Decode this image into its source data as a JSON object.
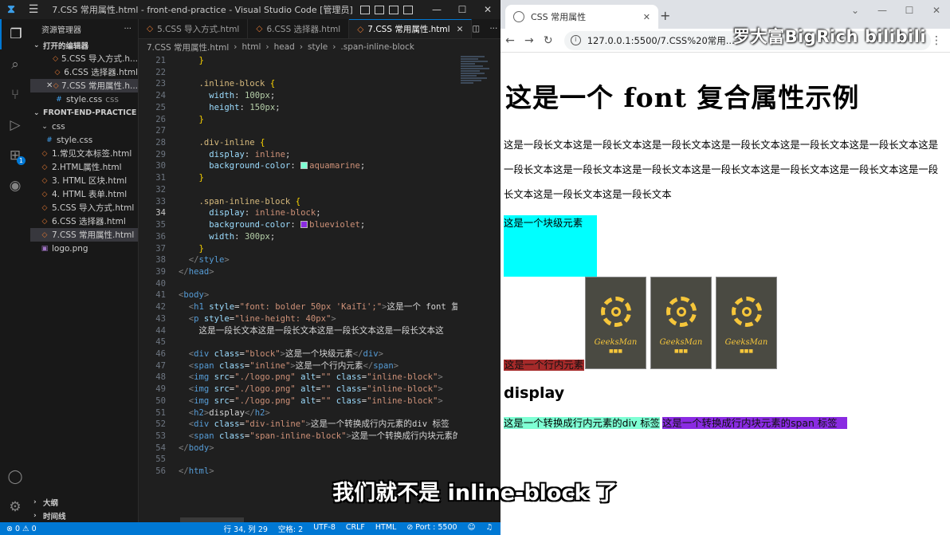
{
  "vscode": {
    "window_title": "7.CSS 常用属性.html - front-end-practice - Visual Studio Code [管理员]",
    "explorer": {
      "header": "资源管理器",
      "open_editors_title": "打开的编辑器",
      "open_editors": [
        {
          "name": "5.CSS 导入方式.h...",
          "type": "html"
        },
        {
          "name": "6.CSS 选择器.html",
          "type": "html"
        },
        {
          "name": "7.CSS 常用属性.h...",
          "type": "html",
          "selected": true
        },
        {
          "name": "style.css",
          "suffix": "css",
          "type": "css"
        }
      ],
      "project_title": "FRONT-END-PRACTICE",
      "files": [
        {
          "name": "css",
          "type": "folder"
        },
        {
          "name": "style.css",
          "type": "css"
        },
        {
          "name": "1.常见文本标签.html",
          "type": "html"
        },
        {
          "name": "2.HTML属性.html",
          "type": "html"
        },
        {
          "name": "3. HTML 区块.html",
          "type": "html"
        },
        {
          "name": "4. HTML 表单.html",
          "type": "html"
        },
        {
          "name": "5.CSS 导入方式.html",
          "type": "html"
        },
        {
          "name": "6.CSS 选择器.html",
          "type": "html"
        },
        {
          "name": "7.CSS 常用属性.html",
          "type": "html",
          "selected": true
        },
        {
          "name": "logo.png",
          "type": "img"
        }
      ],
      "outline_label": "大纲",
      "timeline_label": "时间线"
    },
    "tabs": [
      {
        "label": "5.CSS 导入方式.html",
        "active": false
      },
      {
        "label": "6.CSS 选择器.html",
        "active": false
      },
      {
        "label": "7.CSS 常用属性.html",
        "active": true
      }
    ],
    "breadcrumbs": [
      "7.CSS 常用属性.html",
      "html",
      "head",
      "style",
      ".span-inline-block"
    ],
    "current_line": 34,
    "statusbar": {
      "problems": "⊗ 0 ⚠ 0",
      "position": "行 34, 列 29",
      "spaces": "空格: 2",
      "encoding": "UTF-8",
      "eol": "CRLF",
      "language": "HTML",
      "port": "⊘ Port : 5500"
    }
  },
  "browser": {
    "tab_title": "CSS 常用属性",
    "url": "127.0.0.1:5500/7.CSS%20常用...",
    "page": {
      "h1": "这是一个 font 复合属性示例",
      "paragraph": "这是一段长文本这是一段长文本这是一段长文本这是一段长文本这是一段长文本这是一段长文本这是一段长文本这是一段长文本这是一段长文本这是一段长文本这是一段长文本这是一段长文本这是一段长文本这是一段长文本这是一段长文本",
      "block_text": "这是一个块级元素",
      "inline_text": "这是一个行内元素",
      "logo_brand": "GeeksMan",
      "logo_dots": "■■■",
      "h2": "display",
      "div_inline_text": "这是一个转换成行内元素的div 标签",
      "span_ib_text": "这是一个转换成行内块元素的span 标签"
    }
  },
  "watermark": "罗大富BigRich bilibili",
  "subtitle": "我们就不是 inline-block 了",
  "colors": {
    "block": "#00ffff",
    "inline": "#a52a2a",
    "div_inline": "#7fffd4",
    "span_inline_block": "#8a2be2",
    "accent": "#0078d4"
  },
  "code_lines": [
    {
      "n": 21,
      "segs": [
        [
          "t-brk",
          "    }"
        ]
      ]
    },
    {
      "n": 22,
      "segs": [
        [
          "t-txt",
          ""
        ]
      ]
    },
    {
      "n": 23,
      "segs": [
        [
          "t-sel",
          "    .inline-block "
        ],
        [
          "t-brk",
          "{"
        ]
      ]
    },
    {
      "n": 24,
      "segs": [
        [
          "t-prop",
          "      width"
        ],
        [
          "t-txt",
          ": "
        ],
        [
          "t-num",
          "100px"
        ],
        [
          "t-txt",
          ";"
        ]
      ]
    },
    {
      "n": 25,
      "segs": [
        [
          "t-prop",
          "      height"
        ],
        [
          "t-txt",
          ": "
        ],
        [
          "t-num",
          "150px"
        ],
        [
          "t-txt",
          ";"
        ]
      ]
    },
    {
      "n": 26,
      "segs": [
        [
          "t-brk",
          "    }"
        ]
      ]
    },
    {
      "n": 27,
      "segs": [
        [
          "t-txt",
          ""
        ]
      ]
    },
    {
      "n": 28,
      "segs": [
        [
          "t-sel",
          "    .div-inline "
        ],
        [
          "t-brk",
          "{"
        ]
      ]
    },
    {
      "n": 29,
      "segs": [
        [
          "t-prop",
          "      display"
        ],
        [
          "t-txt",
          ": "
        ],
        [
          "t-val",
          "inline"
        ],
        [
          "t-txt",
          ";"
        ]
      ]
    },
    {
      "n": 30,
      "segs": [
        [
          "t-prop",
          "      background-color"
        ],
        [
          "t-txt",
          ": "
        ],
        [
          "swatch",
          "#7fffd4"
        ],
        [
          "t-val",
          "aquamarine"
        ],
        [
          "t-txt",
          ";"
        ]
      ]
    },
    {
      "n": 31,
      "segs": [
        [
          "t-brk",
          "    }"
        ]
      ]
    },
    {
      "n": 32,
      "segs": [
        [
          "t-txt",
          ""
        ]
      ]
    },
    {
      "n": 33,
      "segs": [
        [
          "t-sel",
          "    .span-inline-block "
        ],
        [
          "t-brk",
          "{"
        ]
      ]
    },
    {
      "n": 34,
      "segs": [
        [
          "t-prop",
          "      display"
        ],
        [
          "t-txt",
          ": "
        ],
        [
          "t-val",
          "inline-block"
        ],
        [
          "t-txt",
          ";"
        ]
      ]
    },
    {
      "n": 35,
      "segs": [
        [
          "t-prop",
          "      background-color"
        ],
        [
          "t-txt",
          ": "
        ],
        [
          "swatch",
          "#8a2be2"
        ],
        [
          "t-val",
          "blueviolet"
        ],
        [
          "t-txt",
          ";"
        ]
      ]
    },
    {
      "n": 36,
      "segs": [
        [
          "t-prop",
          "      width"
        ],
        [
          "t-txt",
          ": "
        ],
        [
          "t-num",
          "300px"
        ],
        [
          "t-txt",
          ";"
        ]
      ]
    },
    {
      "n": 37,
      "segs": [
        [
          "t-brk",
          "    }"
        ]
      ]
    },
    {
      "n": 38,
      "segs": [
        [
          "t-punct",
          "  </"
        ],
        [
          "t-tag",
          "style"
        ],
        [
          "t-punct",
          ">"
        ]
      ]
    },
    {
      "n": 39,
      "segs": [
        [
          "t-punct",
          "</"
        ],
        [
          "t-tag",
          "head"
        ],
        [
          "t-punct",
          ">"
        ]
      ]
    },
    {
      "n": 40,
      "segs": [
        [
          "t-txt",
          ""
        ]
      ]
    },
    {
      "n": 41,
      "segs": [
        [
          "t-punct",
          "<"
        ],
        [
          "t-tag",
          "body"
        ],
        [
          "t-punct",
          ">"
        ]
      ]
    },
    {
      "n": 42,
      "segs": [
        [
          "t-punct",
          "  <"
        ],
        [
          "t-tag",
          "h1 "
        ],
        [
          "t-attr",
          "style"
        ],
        [
          "t-txt",
          "="
        ],
        [
          "t-str",
          "\"font: bolder 50px 'KaiTi';\""
        ],
        [
          "t-punct",
          ">"
        ],
        [
          "t-txt",
          "这是一个 font 复合"
        ]
      ]
    },
    {
      "n": 43,
      "segs": [
        [
          "t-punct",
          "  <"
        ],
        [
          "t-tag",
          "p "
        ],
        [
          "t-attr",
          "style"
        ],
        [
          "t-txt",
          "="
        ],
        [
          "t-str",
          "\"line-height: 40px\""
        ],
        [
          "t-punct",
          ">"
        ]
      ]
    },
    {
      "n": 44,
      "segs": [
        [
          "t-txt",
          "    这是一段长文本这是一段长文本这是一段长文本这是一段长文本这"
        ]
      ]
    },
    {
      "n": 45,
      "segs": [
        [
          "t-txt",
          ""
        ]
      ]
    },
    {
      "n": 46,
      "segs": [
        [
          "t-punct",
          "  <"
        ],
        [
          "t-tag",
          "div "
        ],
        [
          "t-attr",
          "class"
        ],
        [
          "t-txt",
          "="
        ],
        [
          "t-str",
          "\"block\""
        ],
        [
          "t-punct",
          ">"
        ],
        [
          "t-txt",
          "这是一个块级元素"
        ],
        [
          "t-punct",
          "</"
        ],
        [
          "t-tag",
          "div"
        ],
        [
          "t-punct",
          ">"
        ]
      ]
    },
    {
      "n": 47,
      "segs": [
        [
          "t-punct",
          "  <"
        ],
        [
          "t-tag",
          "span "
        ],
        [
          "t-attr",
          "class"
        ],
        [
          "t-txt",
          "="
        ],
        [
          "t-str",
          "\"inline\""
        ],
        [
          "t-punct",
          ">"
        ],
        [
          "t-txt",
          "这是一个行内元素"
        ],
        [
          "t-punct",
          "</"
        ],
        [
          "t-tag",
          "span"
        ],
        [
          "t-punct",
          ">"
        ]
      ]
    },
    {
      "n": 48,
      "segs": [
        [
          "t-punct",
          "  <"
        ],
        [
          "t-tag",
          "img "
        ],
        [
          "t-attr",
          "src"
        ],
        [
          "t-txt",
          "="
        ],
        [
          "t-str",
          "\"./logo.png\""
        ],
        [
          "t-attr",
          " alt"
        ],
        [
          "t-txt",
          "="
        ],
        [
          "t-str",
          "\"\""
        ],
        [
          "t-attr",
          " class"
        ],
        [
          "t-txt",
          "="
        ],
        [
          "t-str",
          "\"inline-block\""
        ],
        [
          "t-punct",
          ">"
        ]
      ]
    },
    {
      "n": 49,
      "segs": [
        [
          "t-punct",
          "  <"
        ],
        [
          "t-tag",
          "img "
        ],
        [
          "t-attr",
          "src"
        ],
        [
          "t-txt",
          "="
        ],
        [
          "t-str",
          "\"./logo.png\""
        ],
        [
          "t-attr",
          " alt"
        ],
        [
          "t-txt",
          "="
        ],
        [
          "t-str",
          "\"\""
        ],
        [
          "t-attr",
          " class"
        ],
        [
          "t-txt",
          "="
        ],
        [
          "t-str",
          "\"inline-block\""
        ],
        [
          "t-punct",
          ">"
        ]
      ]
    },
    {
      "n": 50,
      "segs": [
        [
          "t-punct",
          "  <"
        ],
        [
          "t-tag",
          "img "
        ],
        [
          "t-attr",
          "src"
        ],
        [
          "t-txt",
          "="
        ],
        [
          "t-str",
          "\"./logo.png\""
        ],
        [
          "t-attr",
          " alt"
        ],
        [
          "t-txt",
          "="
        ],
        [
          "t-str",
          "\"\""
        ],
        [
          "t-attr",
          " class"
        ],
        [
          "t-txt",
          "="
        ],
        [
          "t-str",
          "\"inline-block\""
        ],
        [
          "t-punct",
          ">"
        ]
      ]
    },
    {
      "n": 51,
      "segs": [
        [
          "t-punct",
          "  <"
        ],
        [
          "t-tag",
          "h2"
        ],
        [
          "t-punct",
          ">"
        ],
        [
          "t-txt",
          "display"
        ],
        [
          "t-punct",
          "</"
        ],
        [
          "t-tag",
          "h2"
        ],
        [
          "t-punct",
          ">"
        ]
      ]
    },
    {
      "n": 52,
      "segs": [
        [
          "t-punct",
          "  <"
        ],
        [
          "t-tag",
          "div "
        ],
        [
          "t-attr",
          "class"
        ],
        [
          "t-txt",
          "="
        ],
        [
          "t-str",
          "\"div-inline\""
        ],
        [
          "t-punct",
          ">"
        ],
        [
          "t-txt",
          "这是一个转换成行内元素的div 标签"
        ]
      ]
    },
    {
      "n": 53,
      "segs": [
        [
          "t-punct",
          "  <"
        ],
        [
          "t-tag",
          "span "
        ],
        [
          "t-attr",
          "class"
        ],
        [
          "t-txt",
          "="
        ],
        [
          "t-str",
          "\"span-inline-block\""
        ],
        [
          "t-punct",
          ">"
        ],
        [
          "t-txt",
          "这是一个转换成行内块元素的"
        ]
      ]
    },
    {
      "n": 54,
      "segs": [
        [
          "t-punct",
          "</"
        ],
        [
          "t-tag",
          "body"
        ],
        [
          "t-punct",
          ">"
        ]
      ]
    },
    {
      "n": 55,
      "segs": [
        [
          "t-txt",
          ""
        ]
      ]
    },
    {
      "n": 56,
      "segs": [
        [
          "t-punct",
          "</"
        ],
        [
          "t-tag",
          "html"
        ],
        [
          "t-punct",
          ">"
        ]
      ]
    }
  ]
}
